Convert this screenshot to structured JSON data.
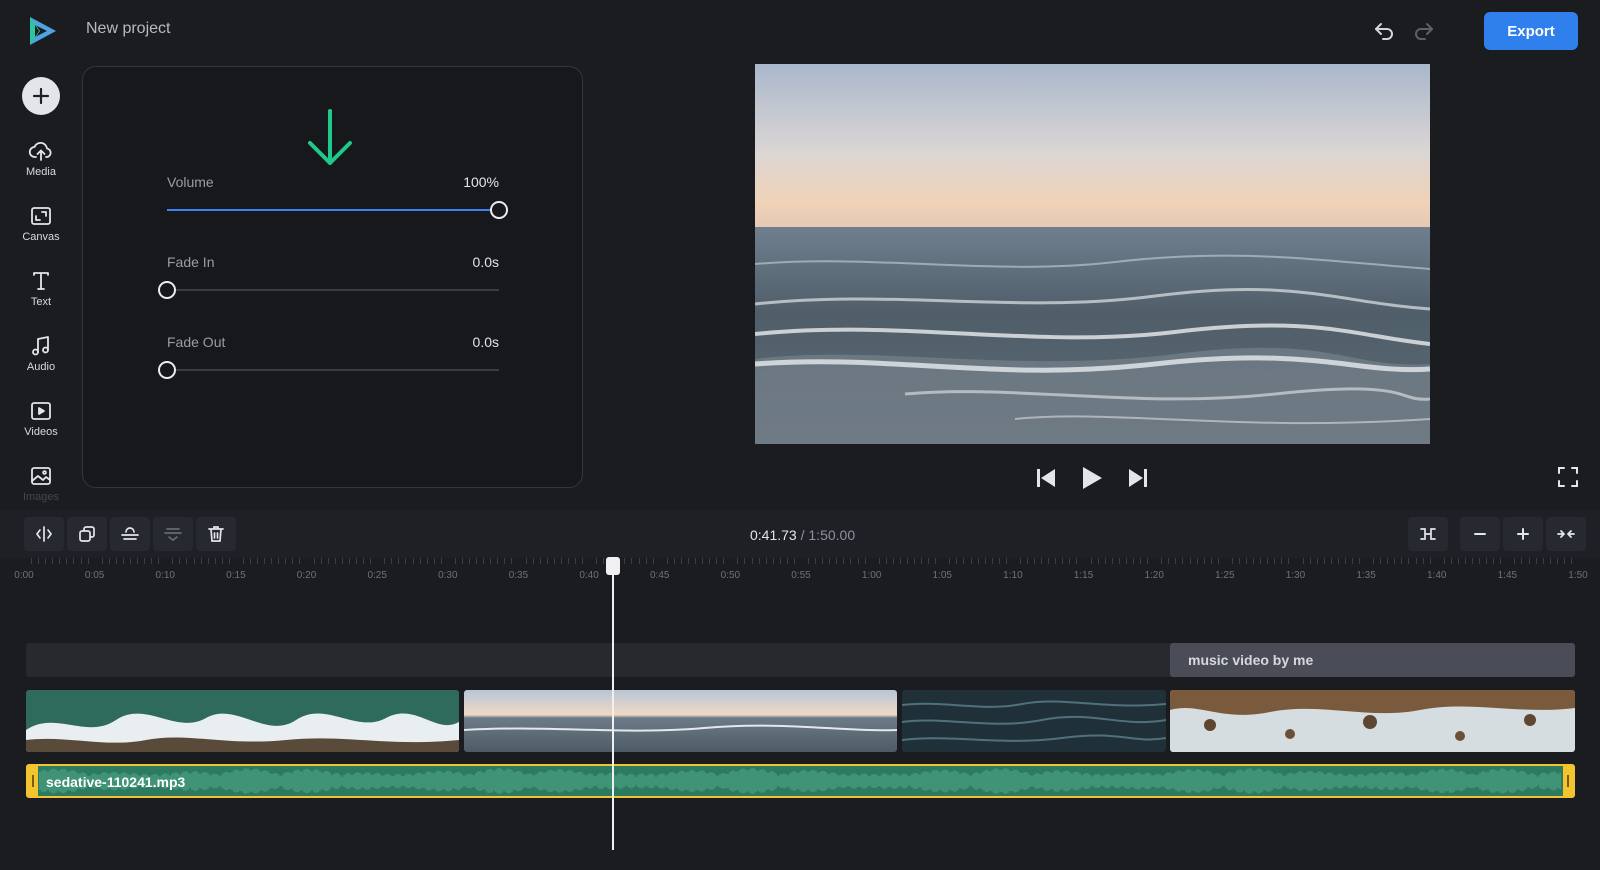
{
  "header": {
    "project_title": "New project",
    "export_label": "Export"
  },
  "sidebar": {
    "items": [
      {
        "label": "Media",
        "icon": "cloud-upload-icon"
      },
      {
        "label": "Canvas",
        "icon": "canvas-icon"
      },
      {
        "label": "Text",
        "icon": "text-icon"
      },
      {
        "label": "Audio",
        "icon": "music-note-icon"
      },
      {
        "label": "Videos",
        "icon": "video-icon"
      },
      {
        "label": "Images",
        "icon": "image-icon"
      }
    ]
  },
  "audio_panel": {
    "volume": {
      "label": "Volume",
      "value_text": "100%",
      "value": 1.0
    },
    "fade_in": {
      "label": "Fade In",
      "value_text": "0.0s",
      "value": 0.0
    },
    "fade_out": {
      "label": "Fade Out",
      "value_text": "0.0s",
      "value": 0.0
    }
  },
  "timeline": {
    "current_time": "0:41.73",
    "separator": "/",
    "total_time": "1:50.00",
    "ruler_labels": [
      "0:00",
      "0:05",
      "0:10",
      "0:15",
      "0:20",
      "0:25",
      "0:30",
      "0:35",
      "0:40",
      "0:45",
      "0:50",
      "0:55",
      "1:00",
      "1:05",
      "1:10",
      "1:15",
      "1:20",
      "1:25",
      "1:30",
      "1:35",
      "1:40",
      "1:45",
      "1:50"
    ],
    "text_clip_label": "music video by me",
    "audio_clip_name": "sedative-110241.mp3"
  },
  "colors": {
    "accent": "#2f80ed",
    "audio_clip": "#2c7a5f",
    "selection": "#f4c430",
    "arrow": "#1ec98a"
  }
}
